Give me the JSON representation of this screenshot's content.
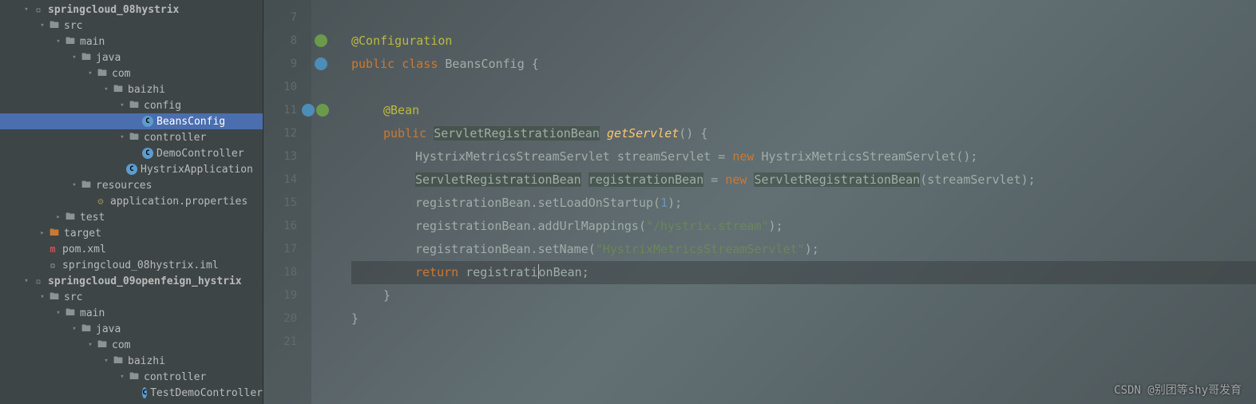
{
  "tree": {
    "n0": "springcloud_08hystrix",
    "n1": "src",
    "n2": "main",
    "n3": "java",
    "n4": "com",
    "n5": "baizhi",
    "n6": "config",
    "n7": "BeansConfig",
    "n8": "controller",
    "n9": "DemoController",
    "n10": "HystrixApplication",
    "n11": "resources",
    "n12": "application.properties",
    "n13": "test",
    "n14": "target",
    "n15": "pom.xml",
    "n16": "springcloud_08hystrix.iml",
    "n17": "springcloud_09openfeign_hystrix",
    "n18": "src",
    "n19": "main",
    "n20": "java",
    "n21": "com",
    "n22": "baizhi",
    "n23": "controller",
    "n24": "TestDemoController"
  },
  "lines": {
    "l7": "7",
    "l8": "8",
    "l9": "9",
    "l10": "10",
    "l11": "11",
    "l12": "12",
    "l13": "13",
    "l14": "14",
    "l15": "15",
    "l16": "16",
    "l17": "17",
    "l18": "18",
    "l19": "19",
    "l20": "20",
    "l21": "21"
  },
  "code": {
    "anno_conf": "@Configuration",
    "anno_bean": "@Bean",
    "kw_public": "public",
    "kw_class": "class",
    "kw_new": "new",
    "kw_return": "return",
    "cls_beans": "BeansConfig",
    "cls_srb": "ServletRegistrationBean",
    "cls_hmss": "HystrixMetricsStreamServlet",
    "m_getServlet": "getServlet",
    "m_setLoad": "setLoadOnStartup",
    "m_addUrl": "addUrlMappings",
    "m_setName": "setName",
    "v_stream": "streamServlet",
    "v_reg": "registrationBean",
    "s_url": "\"/hystrix.stream\"",
    "s_name": "\"HystrixMetricsStreamServlet\"",
    "n_one": "1",
    "lbrace": "{",
    "rbrace": "}",
    "lparen": "(",
    "rparen": ")",
    "semi": ";",
    "dot": ".",
    "eq": " = ",
    "space": " ",
    "empty_parens": "()"
  },
  "watermark": "CSDN @别团等shy哥发育"
}
